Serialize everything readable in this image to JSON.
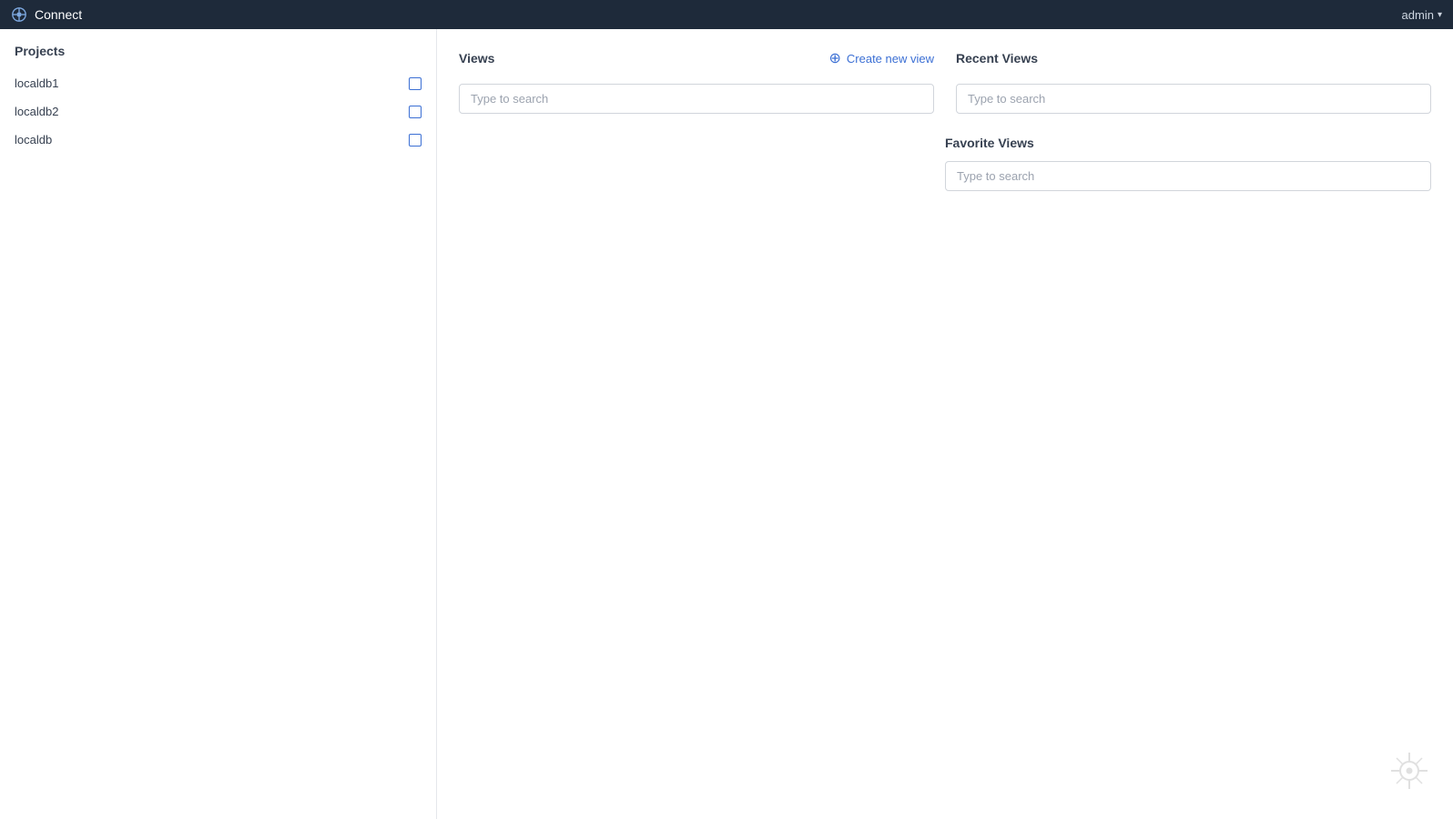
{
  "app": {
    "title": "Connect",
    "user": "admin"
  },
  "sidebar": {
    "header": "Projects",
    "items": [
      {
        "id": "localdb1",
        "label": "localdb1"
      },
      {
        "id": "localdb2",
        "label": "localdb2"
      },
      {
        "id": "localdb",
        "label": "localdb"
      }
    ]
  },
  "views": {
    "header": "Views",
    "create_label": "Create new view",
    "search_placeholder": "Type to search"
  },
  "recent_views": {
    "header": "Recent Views",
    "search_placeholder": "Type to search"
  },
  "favorite_views": {
    "header": "Favorite Views",
    "search_placeholder": "Type to search"
  }
}
